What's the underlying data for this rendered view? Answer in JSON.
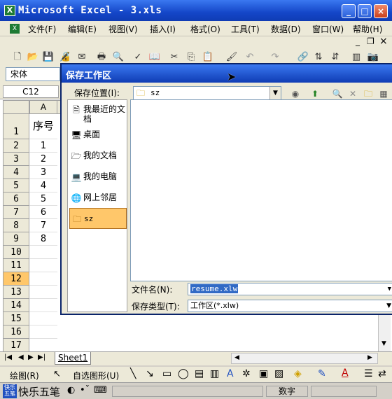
{
  "app": {
    "title": "Microsoft Excel - 3.xls",
    "minimize": "_",
    "maximize": "□",
    "close": "×",
    "colors": {
      "titlebar": "#1446c8",
      "selected_place": "#ffc76a",
      "selection": "#316ac5"
    }
  },
  "menu": {
    "items": [
      "文件(F)",
      "编辑(E)",
      "视图(V)",
      "插入(I)",
      "格式(O)",
      "工具(T)",
      "数据(D)",
      "窗口(W)",
      "帮助(H)"
    ],
    "doc_min": "_",
    "doc_restore": "❐",
    "doc_close": "×"
  },
  "formatting": {
    "font_name": "宋体"
  },
  "namebox": "C12",
  "sheet": {
    "col_a": "A",
    "rows": [
      "1",
      "2",
      "3",
      "4",
      "5",
      "6",
      "7",
      "8",
      "9",
      "10",
      "11",
      "12",
      "13",
      "14",
      "15",
      "16",
      "17"
    ],
    "col_a_values": [
      "序号",
      "1",
      "2",
      "3",
      "4",
      "5",
      "6",
      "7",
      "8",
      "",
      "",
      "",
      "",
      "",
      "",
      "",
      ""
    ],
    "tab": "Sheet1"
  },
  "dialog": {
    "title": "保存工作区",
    "location_label": "保存位置(I):",
    "location_value": "sz",
    "places": [
      {
        "icon": "recent-docs-icon",
        "label": "我最近的文档"
      },
      {
        "icon": "desktop-icon",
        "label": "桌面"
      },
      {
        "icon": "my-documents-icon",
        "label": "我的文档"
      },
      {
        "icon": "my-computer-icon",
        "label": "我的电脑"
      },
      {
        "icon": "network-icon",
        "label": "网上邻居"
      },
      {
        "icon": "folder-icon",
        "label": "sz"
      }
    ],
    "filename_label": "文件名(N):",
    "filename_value": "resume.xlw",
    "filetype_label": "保存类型(T):",
    "filetype_value": "工作区(*.xlw)"
  },
  "drawing": {
    "draw_label": "绘图(R)",
    "autoshapes_label": "自选图形(U)"
  },
  "status": {
    "ime_name": "快乐五笔",
    "ime_logo": "快乐五笔",
    "num": "数字"
  }
}
